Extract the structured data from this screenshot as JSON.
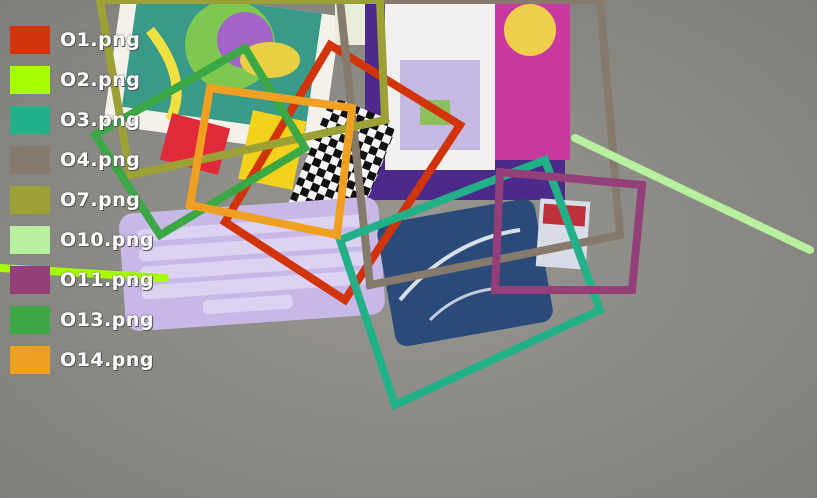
{
  "legend": [
    {
      "label": "O1.png",
      "color": "#d1330a"
    },
    {
      "label": "O2.png",
      "color": "#a6ff00"
    },
    {
      "label": "O3.png",
      "color": "#22b088"
    },
    {
      "label": "O4.png",
      "color": "#857a6c"
    },
    {
      "label": "O7.png",
      "color": "#9ba135"
    },
    {
      "label": "O10.png",
      "color": "#b8f0a0"
    },
    {
      "label": "O11.png",
      "color": "#943f7a"
    },
    {
      "label": "O13.png",
      "color": "#3ba845"
    },
    {
      "label": "O14.png",
      "color": "#f0a020"
    }
  ]
}
